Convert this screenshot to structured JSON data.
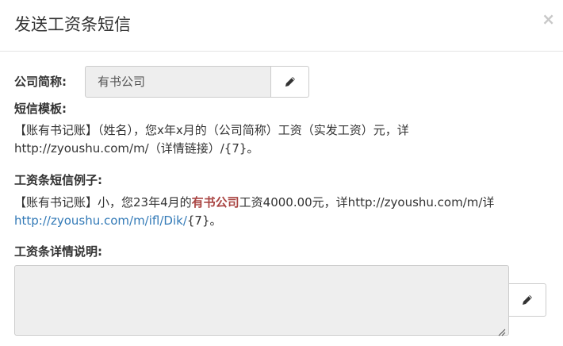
{
  "modal": {
    "title": "发送工资条短信",
    "close_symbol": "×"
  },
  "company": {
    "label": "公司简称:",
    "value": "有书公司"
  },
  "template": {
    "label": "短信模板:",
    "line1": "【账有书记账】（姓名），您x年x月的（公司简称）工资（实发工资）元，详",
    "line2": "http://zyoushu.com/m/（详情链接）/{7}。"
  },
  "example": {
    "label": "工资条短信例子:",
    "line1_prefix": "【账有书记账】小，您23年4月的",
    "line1_company": "有书公司",
    "line1_suffix": "工资4000.00元，详http://zyoushu.com/m/详",
    "line2_link": "http://zyoushu.com/m/ifl/Dik/",
    "line2_suffix": "{7}。"
  },
  "detail": {
    "label": "工资条详情说明:",
    "value": ""
  },
  "icons": {
    "edit": "pencil-icon",
    "close": "close-icon",
    "resize": "resize-handle-icon"
  },
  "colors": {
    "company_highlight": "#a94442",
    "link": "#337ab7",
    "readonly_bg": "#eeeeee"
  }
}
